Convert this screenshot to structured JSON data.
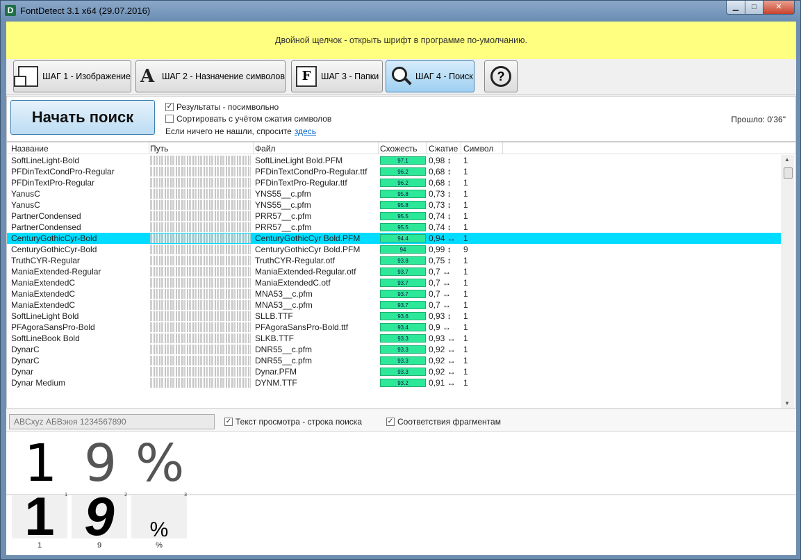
{
  "window": {
    "title": "FontDetect 3.1 x64 (29.07.2016)",
    "app_icon_letter": "D",
    "minimize": "▁",
    "maximize": "□",
    "close": "✕"
  },
  "banner": {
    "text": "Двойной щелчок - открыть шрифт в программе по-умолчанию."
  },
  "steps": [
    {
      "label": "ШАГ 1 - Изображение",
      "icon": "image-icon"
    },
    {
      "label": "ШАГ 2 - Назначение символов",
      "icon": "letter-a-icon"
    },
    {
      "label": "ШАГ 3 - Папки",
      "icon": "folder-f-icon"
    },
    {
      "label": "ШАГ 4 - Поиск",
      "icon": "magnifier-icon"
    }
  ],
  "help": {
    "label": "?"
  },
  "search": {
    "start_button": "Начать поиск",
    "opt_per_symbol": "Результаты - посимвольно",
    "opt_sort_compress": "Сортировать с учётом сжатия символов",
    "ask_text": "Если ничего не нашли, спросите",
    "ask_link": "здесь",
    "elapsed": "Прошло: 0'36\"",
    "check_mark": "✓"
  },
  "columns": {
    "name": "Название",
    "path": "Путь",
    "file": "Файл",
    "similarity": "Схожесть",
    "compression": "Сжатие",
    "symbol": "Символ"
  },
  "rows": [
    {
      "name": "SoftLineLight-Bold",
      "file": "SoftLineLight Bold.PFM",
      "sim": "97.1",
      "comp": "0,98 ↕",
      "sym": "1"
    },
    {
      "name": "PFDinTextCondPro-Regular",
      "file": "PFDinTextCondPro-Regular.ttf",
      "sim": "96.2",
      "comp": "0,68 ↕",
      "sym": "1"
    },
    {
      "name": "PFDinTextPro-Regular",
      "file": "PFDinTextPro-Regular.ttf",
      "sim": "96.2",
      "comp": "0,68 ↕",
      "sym": "1"
    },
    {
      "name": "YanusC",
      "file": "YNS55__c.pfm",
      "sim": "95.8",
      "comp": "0,73 ↕",
      "sym": "1"
    },
    {
      "name": "YanusC",
      "file": "YNS55__c.pfm",
      "sim": "95.8",
      "comp": "0,73 ↕",
      "sym": "1"
    },
    {
      "name": "PartnerCondensed",
      "file": "PRR57__c.pfm",
      "sim": "95.5",
      "comp": "0,74 ↕",
      "sym": "1"
    },
    {
      "name": "PartnerCondensed",
      "file": "PRR57__c.pfm",
      "sim": "95.5",
      "comp": "0,74 ↕",
      "sym": "1"
    },
    {
      "name": "CenturyGothicCyr-Bold",
      "file": "CenturyGothicCyr Bold.PFM",
      "sim": "94.4",
      "comp": "0,94 ↔",
      "sym": "1",
      "selected": true
    },
    {
      "name": "CenturyGothicCyr-Bold",
      "file": "CenturyGothicCyr Bold.PFM",
      "sim": "94",
      "comp": "0,99 ↕",
      "sym": "9"
    },
    {
      "name": "TruthCYR-Regular",
      "file": "TruthCYR-Regular.otf",
      "sim": "93.8",
      "comp": "0,75 ↕",
      "sym": "1"
    },
    {
      "name": "ManiaExtended-Regular",
      "file": "ManiaExtended-Regular.otf",
      "sim": "93.7",
      "comp": "0,7 ↔",
      "sym": "1"
    },
    {
      "name": "ManiaExtendedC",
      "file": "ManiaExtendedC.otf",
      "sim": "93.7",
      "comp": "0,7 ↔",
      "sym": "1"
    },
    {
      "name": "ManiaExtendedC",
      "file": "MNA53__c.pfm",
      "sim": "93.7",
      "comp": "0,7 ↔",
      "sym": "1"
    },
    {
      "name": "ManiaExtendedC",
      "file": "MNA53__c.pfm",
      "sim": "93.7",
      "comp": "0,7 ↔",
      "sym": "1"
    },
    {
      "name": "SoftLineLight Bold",
      "file": "SLLB.TTF",
      "sim": "93.6",
      "comp": "0,93 ↕",
      "sym": "1"
    },
    {
      "name": "PFAgoraSansPro-Bold",
      "file": "PFAgoraSansPro-Bold.ttf",
      "sim": "93.4",
      "comp": "0,9 ↔",
      "sym": "1"
    },
    {
      "name": "SoftLineBook Bold",
      "file": "SLKB.TTF",
      "sim": "93.3",
      "comp": "0,93 ↔",
      "sym": "1"
    },
    {
      "name": "DynarC",
      "file": "DNR55__c.pfm",
      "sim": "93.3",
      "comp": "0,92 ↔",
      "sym": "1"
    },
    {
      "name": "DynarC",
      "file": "DNR55__c.pfm",
      "sim": "93.3",
      "comp": "0,92 ↔",
      "sym": "1"
    },
    {
      "name": "Dynar",
      "file": "Dynar.PFM",
      "sim": "93.3",
      "comp": "0,92 ↔",
      "sym": "1"
    },
    {
      "name": "Dynar Medium",
      "file": "DYNM.TTF",
      "sim": "93.2",
      "comp": "0,91 ↔",
      "sym": "1"
    }
  ],
  "preview": {
    "placeholder": "ABCxyz АБВэюя 1234567890",
    "opt_search_string": "Текст просмотра - строка поиска",
    "opt_fragments": "Соответствия фрагментам"
  },
  "big_glyphs": [
    "1",
    "9",
    "%"
  ],
  "fragments": [
    {
      "glyph": "1",
      "caption": "1",
      "num": "1"
    },
    {
      "glyph": "9",
      "caption": "9",
      "num": "2"
    },
    {
      "glyph": "%",
      "caption": "%",
      "num": "3"
    }
  ]
}
